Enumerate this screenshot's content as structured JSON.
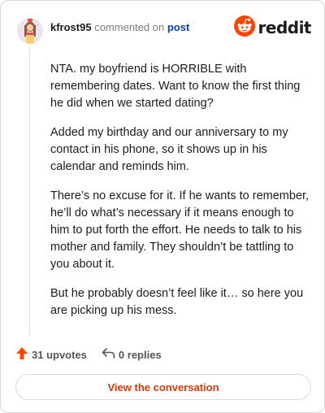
{
  "comment": {
    "username": "kfrost95",
    "action": "commented on",
    "target": "post",
    "paragraphs": [
      "NTA. my boyfriend is HORRIBLE with remembering dates. Want to know the first thing he did when we started dating?",
      "Added my birthday and our anniversary to my contact in his phone, so it shows up in his calendar and reminds him.",
      "There’s no excuse for it. If he wants to remember, he’ll do what’s necessary if it means enough to him to put forth the effort. He needs to talk to his mother and family. They shouldn’t be tattling to you about it.",
      "But he probably doesn’t feel like it… so here you are picking up his mess."
    ]
  },
  "brand": {
    "name": "reddit",
    "color": "#ff4500"
  },
  "stats": {
    "upvotes": "31 upvotes",
    "replies": "0 replies"
  },
  "cta": {
    "label": "View the conversation",
    "color": "#d93900"
  },
  "icons": {
    "avatar": "avatar",
    "logo": "reddit-snoo-icon",
    "upvote": "upvote-arrow-icon",
    "reply": "reply-arrow-icon"
  }
}
